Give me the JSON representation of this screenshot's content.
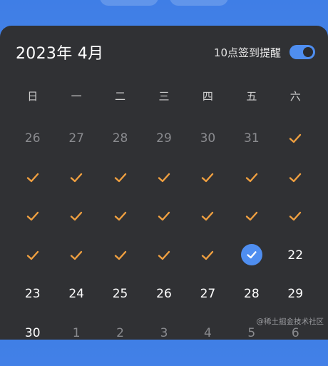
{
  "calendar": {
    "month_title": "2023年 4月",
    "reminder_label": "10点签到提醒",
    "reminder_on": true,
    "weekdays": [
      "日",
      "一",
      "二",
      "三",
      "四",
      "五",
      "六"
    ],
    "rows": [
      [
        {
          "t": "num",
          "v": "26",
          "style": "prev"
        },
        {
          "t": "num",
          "v": "27",
          "style": "prev"
        },
        {
          "t": "num",
          "v": "28",
          "style": "prev"
        },
        {
          "t": "num",
          "v": "29",
          "style": "prev"
        },
        {
          "t": "num",
          "v": "30",
          "style": "prev"
        },
        {
          "t": "num",
          "v": "31",
          "style": "prev"
        },
        {
          "t": "check"
        }
      ],
      [
        {
          "t": "check"
        },
        {
          "t": "check"
        },
        {
          "t": "check"
        },
        {
          "t": "check"
        },
        {
          "t": "check"
        },
        {
          "t": "check"
        },
        {
          "t": "check"
        }
      ],
      [
        {
          "t": "check"
        },
        {
          "t": "check"
        },
        {
          "t": "check"
        },
        {
          "t": "check"
        },
        {
          "t": "check"
        },
        {
          "t": "check"
        },
        {
          "t": "check"
        }
      ],
      [
        {
          "t": "check"
        },
        {
          "t": "check"
        },
        {
          "t": "check"
        },
        {
          "t": "check"
        },
        {
          "t": "check"
        },
        {
          "t": "today"
        },
        {
          "t": "num",
          "v": "22",
          "style": "cur"
        }
      ],
      [
        {
          "t": "num",
          "v": "23",
          "style": "cur"
        },
        {
          "t": "num",
          "v": "24",
          "style": "cur"
        },
        {
          "t": "num",
          "v": "25",
          "style": "cur"
        },
        {
          "t": "num",
          "v": "26",
          "style": "cur"
        },
        {
          "t": "num",
          "v": "27",
          "style": "cur"
        },
        {
          "t": "num",
          "v": "28",
          "style": "cur"
        },
        {
          "t": "num",
          "v": "29",
          "style": "cur"
        }
      ],
      [
        {
          "t": "num",
          "v": "30",
          "style": "cur"
        },
        {
          "t": "num",
          "v": "1",
          "style": "prev"
        },
        {
          "t": "num",
          "v": "2",
          "style": "prev"
        },
        {
          "t": "num",
          "v": "3",
          "style": "prev"
        },
        {
          "t": "num",
          "v": "4",
          "style": "prev"
        },
        {
          "t": "num",
          "v": "5",
          "style": "prev"
        },
        {
          "t": "num",
          "v": "6",
          "style": "prev"
        }
      ]
    ]
  },
  "colors": {
    "accent": "#4f8ef0",
    "check": "#f0a040",
    "panel": "#303134"
  },
  "watermark": "@稀土掘金技术社区"
}
